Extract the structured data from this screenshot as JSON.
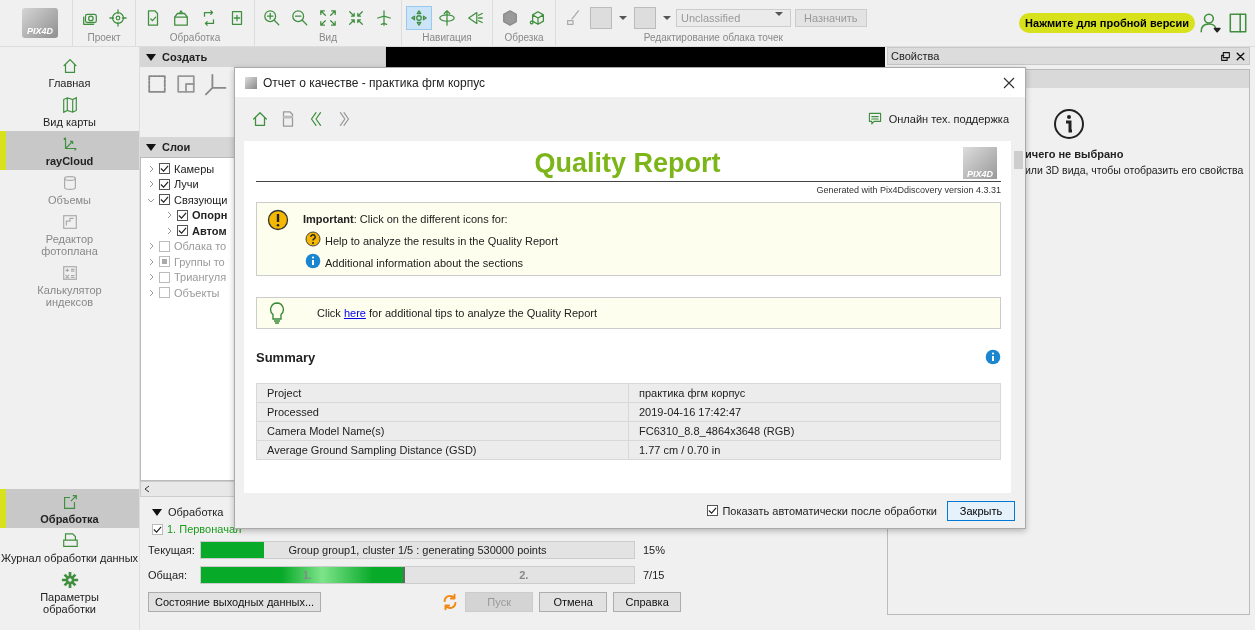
{
  "toolbar": {
    "logo": "PIX4D",
    "groups": [
      {
        "label": "Проект"
      },
      {
        "label": "Обработка"
      },
      {
        "label": "Вид"
      },
      {
        "label": "Навигация",
        "tools": [
          {
            "selected": true
          },
          {
            "selected": false
          },
          {
            "selected": false
          }
        ]
      },
      {
        "label": "Обрезка"
      },
      {
        "label": "Редактирование облака точек",
        "class_select": {
          "value": "Unclassified",
          "disabled": true
        },
        "assign_button": {
          "label": "Назначить",
          "disabled": true
        }
      }
    ],
    "trial_button": "Нажмите для пробной версии"
  },
  "sidebar": {
    "top": [
      {
        "label": "Главная",
        "selected": false,
        "disabled": false
      },
      {
        "label": "Вид карты",
        "selected": false,
        "disabled": false
      },
      {
        "label": "rayCloud",
        "selected": true,
        "disabled": false
      },
      {
        "label": "Объемы",
        "selected": false,
        "disabled": true
      },
      {
        "label": "Редактор\nфотоплана",
        "selected": false,
        "disabled": true
      },
      {
        "label": "Калькулятор\nиндексов",
        "selected": false,
        "disabled": true
      }
    ],
    "bottom": [
      {
        "label": "Обработка",
        "selected": true,
        "disabled": false
      },
      {
        "label": "Журнал обработки данных",
        "selected": false,
        "disabled": false
      },
      {
        "label": "Параметры\nобработки",
        "selected": false,
        "disabled": false
      }
    ]
  },
  "create_panel": {
    "title": "Создать"
  },
  "layers": {
    "title": "Слои",
    "items": [
      {
        "label": "Камеры",
        "checked": true,
        "partial": false,
        "disabled": false,
        "expanded": false
      },
      {
        "label": "Лучи",
        "checked": true,
        "partial": false,
        "disabled": false,
        "expanded": false
      },
      {
        "label": "Связующи",
        "checked": true,
        "partial": false,
        "disabled": false,
        "expanded": true,
        "children": [
          {
            "label": "Опорн",
            "checked": true,
            "partial": false,
            "disabled": false,
            "expanded": false
          },
          {
            "label": "Автом",
            "checked": true,
            "partial": false,
            "disabled": false,
            "expanded": false
          }
        ]
      },
      {
        "label": "Облака то",
        "checked": false,
        "partial": false,
        "disabled": true,
        "expanded": false
      },
      {
        "label": "Группы то",
        "checked": false,
        "partial": true,
        "disabled": true,
        "expanded": false
      },
      {
        "label": "Триангуля",
        "checked": false,
        "partial": false,
        "disabled": true,
        "expanded": false
      },
      {
        "label": "Объекты",
        "checked": false,
        "partial": false,
        "disabled": true,
        "expanded": false
      }
    ]
  },
  "processing": {
    "title": "Обработка",
    "steps": [
      {
        "label": "1. Первоначал",
        "checked": true,
        "color": "#1a9c1a"
      }
    ],
    "current": {
      "label": "Текущая:",
      "level": 0.145,
      "text": "Group group1, cluster 1/5 : generating 530000 points",
      "reading": "15%"
    },
    "total": {
      "label": "Общая:",
      "level": 0.47,
      "segments": [
        "1.",
        "2."
      ],
      "reading": "7/15"
    },
    "buttons": [
      {
        "label": "Состояние выходных данных...",
        "kind": "wide",
        "disabled": false
      },
      {
        "kind": "refresh"
      },
      {
        "label": "Пуск",
        "kind": "normal",
        "disabled": true
      },
      {
        "label": "Отмена",
        "kind": "normal",
        "disabled": false
      },
      {
        "label": "Справка",
        "kind": "normal",
        "disabled": false
      }
    ]
  },
  "properties": {
    "title": "Свойства",
    "heading": "ичего не выбрано",
    "text": "или 3D вида, чтобы отобразить его свойства"
  },
  "dialog": {
    "title": "Отчет о качестве - практика фгм корпус",
    "support": "Онлайн тех. поддержка",
    "report": {
      "title": "Quality Report",
      "logo": "PIX4D",
      "generated": "Generated with Pix4Ddiscovery version 4.3.31",
      "important": {
        "text": "**Important**: Click on the different icons for:",
        "items": [
          {
            "kind": "help",
            "text": "Help to analyze the results in the Quality Report"
          },
          {
            "kind": "info",
            "text": "Additional information about the sections"
          }
        ]
      },
      "tip": {
        "before": "Click",
        "link": "here",
        "after": "for additional tips to analyze the Quality Report"
      },
      "summary_title": "Summary",
      "summary": [
        {
          "label": "Project",
          "value": "практика фгм корпус"
        },
        {
          "label": "Processed",
          "value": "2019-04-16 17:42:47"
        },
        {
          "label": "Camera Model Name(s)",
          "value": "FC6310_8.8_4864x3648 (RGB)"
        },
        {
          "label": "Average Ground Sampling Distance (GSD)",
          "value": "1.77 cm / 0.70 in"
        }
      ]
    },
    "auto_show": {
      "label": "Показать автоматически после обработки",
      "checked": true
    },
    "close_button": "Закрыть"
  }
}
